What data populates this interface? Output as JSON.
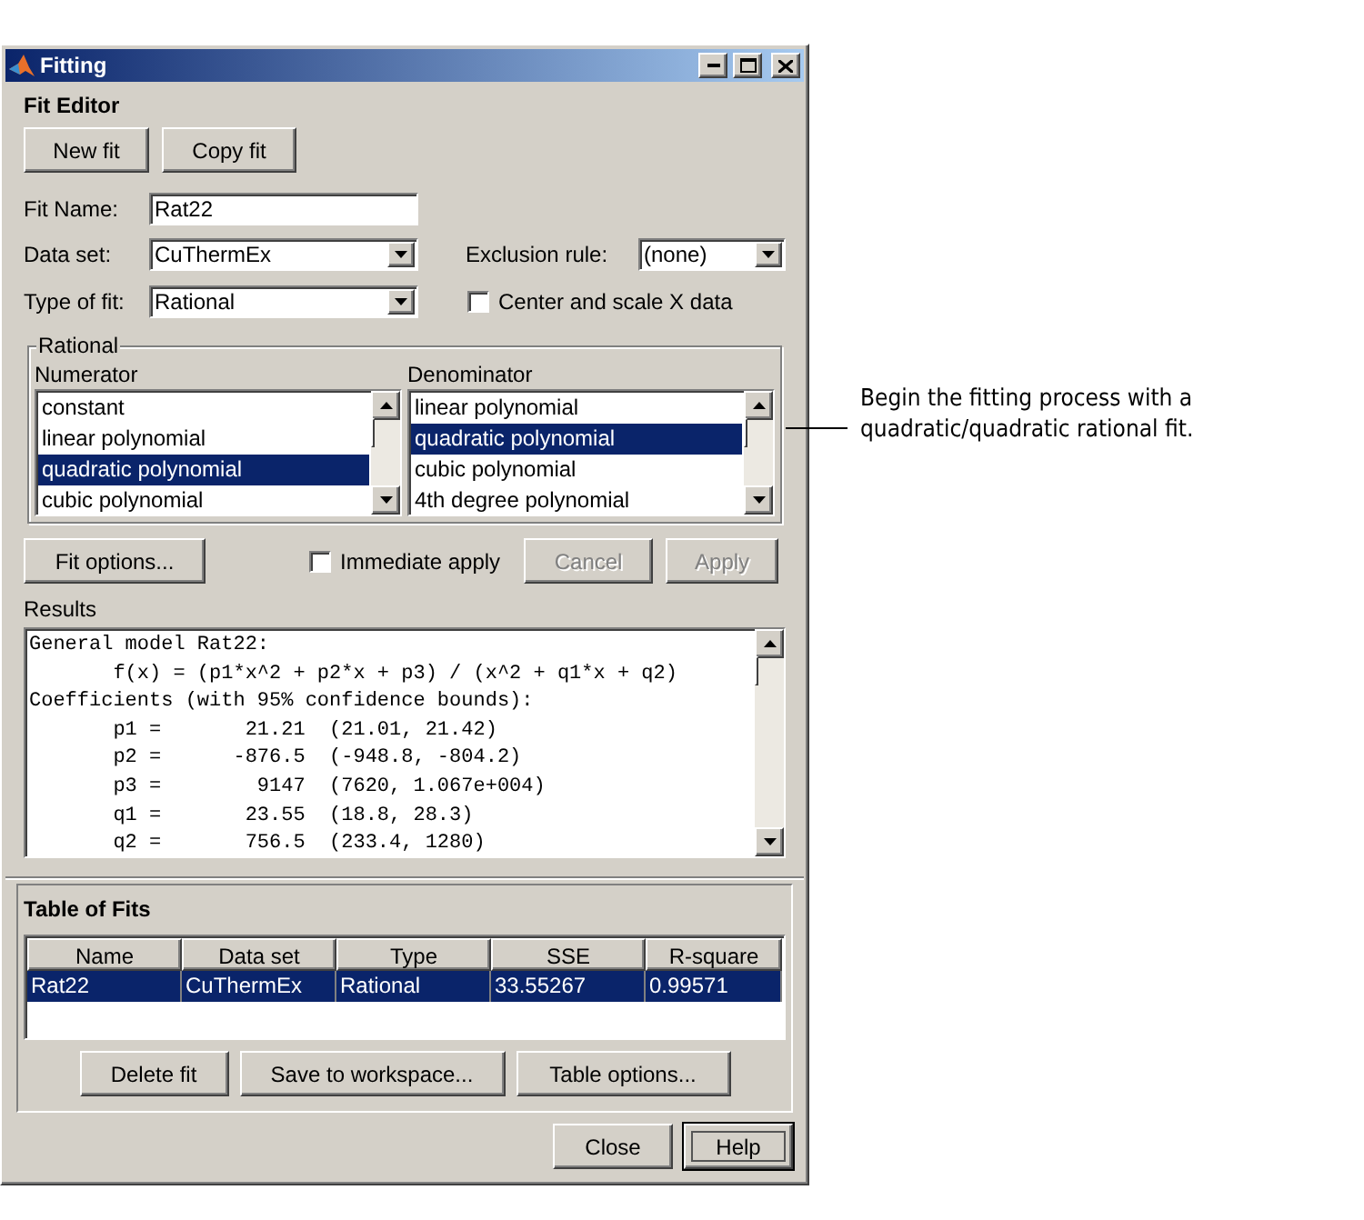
{
  "window": {
    "title": "Fitting"
  },
  "fit_editor": {
    "title": "Fit Editor",
    "buttons": [
      "New fit",
      "Copy fit"
    ],
    "fit_name": {
      "label": "Fit Name:",
      "value": "Rat22"
    },
    "data_set": {
      "label": "Data set:",
      "value": "CuThermEx"
    },
    "exclusion_rule": {
      "label": "Exclusion rule:",
      "value": "(none)"
    },
    "type_of_fit": {
      "label": "Type of fit:",
      "value": "Rational"
    },
    "center_scale": {
      "label": "Center and scale X data",
      "checked": false
    },
    "rational": {
      "title": "Rational",
      "lists": [
        {
          "label": "Numerator",
          "items": [
            {
              "label": "constant",
              "selected": false
            },
            {
              "label": "linear polynomial",
              "selected": false
            },
            {
              "label": "quadratic polynomial",
              "selected": true
            },
            {
              "label": "cubic polynomial",
              "selected": false
            }
          ]
        },
        {
          "label": "Denominator",
          "items": [
            {
              "label": "linear polynomial",
              "selected": false
            },
            {
              "label": "quadratic polynomial",
              "selected": true
            },
            {
              "label": "cubic polynomial",
              "selected": false
            },
            {
              "label": "4th degree polynomial",
              "selected": false
            }
          ]
        }
      ]
    },
    "fit_options": "Fit options...",
    "immediate_apply": {
      "label": "Immediate apply",
      "checked": false
    },
    "action_buttons": [
      {
        "label": "Cancel",
        "disabled": true
      },
      {
        "label": "Apply",
        "disabled": true
      }
    ],
    "results": {
      "label": "Results",
      "lines": [
        "General model Rat22:",
        "       f(x) = (p1*x^2 + p2*x + p3) / (x^2 + q1*x + q2)",
        "Coefficients (with 95% confidence bounds):",
        "       p1 =       21.21  (21.01, 21.42)",
        "       p2 =      -876.5  (-948.8, -804.2)",
        "       p3 =        9147  (7620, 1.067e+004)",
        "       q1 =       23.55  (18.8, 28.3)",
        "       q2 =       756.5  (233.4, 1280)"
      ]
    }
  },
  "table_of_fits": {
    "title": "Table of Fits",
    "columns": [
      "Name",
      "Data set",
      "Type",
      "SSE",
      "R-square"
    ],
    "rows": [
      {
        "cells": [
          "Rat22",
          "CuThermEx",
          "Rational",
          "33.55267",
          "0.99571"
        ],
        "selected": true
      }
    ],
    "buttons": [
      "Delete fit",
      "Save to workspace...",
      "Table options..."
    ]
  },
  "dialog_buttons": [
    {
      "label": "Close",
      "focused": false
    },
    {
      "label": "Help",
      "focused": true
    }
  ],
  "callout": {
    "text": "Begin the fitting process with a quadratic/quadratic rational fit."
  }
}
